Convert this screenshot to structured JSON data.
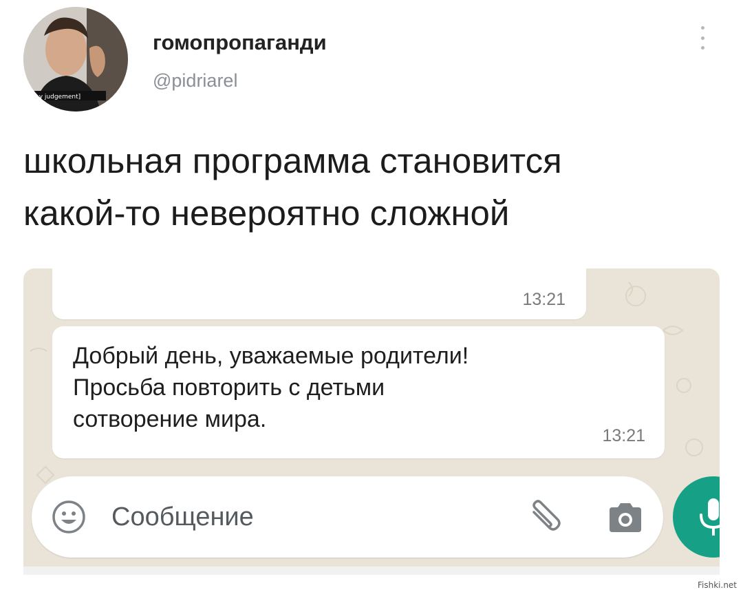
{
  "tweet": {
    "author_name": "гомопропаганди",
    "author_handle": "@pidriarel",
    "avatar_caption": "[gay judgement]",
    "text_line1": "школьная программа становится",
    "text_line2": "какой-то невероятно сложной"
  },
  "chat": {
    "previous_message": {
      "time": "13:21"
    },
    "message": {
      "line1": "Добрый день, уважаемые родители!",
      "line2": "Просьба повторить с детьми",
      "line3": "сотворение мира.",
      "time": "13:21"
    },
    "input": {
      "placeholder": "Сообщение",
      "emoji_icon": "smiley-icon",
      "attach_icon": "paperclip-icon",
      "camera_icon": "camera-icon",
      "send_icon": "microphone-icon"
    },
    "colors": {
      "wallpaper": "#eae3d7",
      "bubble": "#ffffff",
      "mic_button": "#16a085"
    }
  },
  "watermark": "Fishki.net"
}
